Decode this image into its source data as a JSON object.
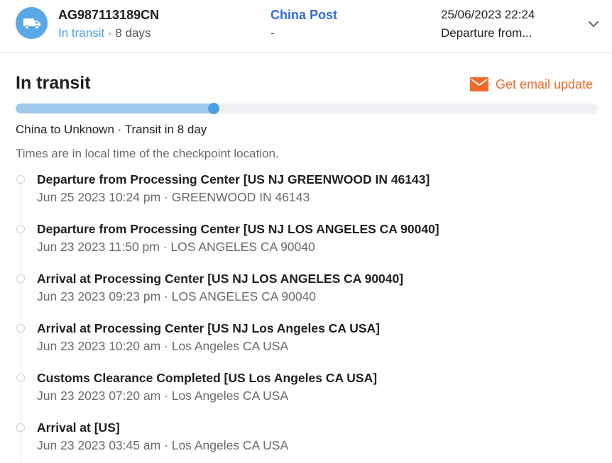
{
  "header": {
    "tracking_number": "AG987113189CN",
    "status": "In transit",
    "duration": " · 8 days",
    "carrier": "China Post",
    "carrier_sub": "-",
    "last_update_time": "25/06/2023 22:24",
    "last_update_event": "Departure from..."
  },
  "main": {
    "title": "In transit",
    "email_button": "Get email update",
    "progress": 0.34,
    "route": "China to Unknown · Transit in 8 day",
    "timezone_note": "Times are in local time of the checkpoint location."
  },
  "events": [
    {
      "title": "Departure from Processing Center [US NJ GREENWOOD IN 46143]",
      "meta": "Jun 25 2023 10:24 pm · GREENWOOD IN 46143"
    },
    {
      "title": "Departure from Processing Center [US NJ LOS ANGELES CA 90040]",
      "meta": "Jun 23 2023 11:50 pm · LOS ANGELES CA 90040"
    },
    {
      "title": "Arrival at Processing Center [US NJ LOS ANGELES CA 90040]",
      "meta": "Jun 23 2023 09:23 pm · LOS ANGELES CA 90040"
    },
    {
      "title": "Arrival at Processing Center [US NJ Los Angeles CA USA]",
      "meta": "Jun 23 2023 10:20 am · Los Angeles CA USA"
    },
    {
      "title": "Customs Clearance Completed [US Los Angeles CA USA]",
      "meta": "Jun 23 2023 07:20 am · Los Angeles CA USA"
    },
    {
      "title": "Arrival at [US]",
      "meta": "Jun 23 2023 03:45 am · Los Angeles CA USA"
    }
  ],
  "colors": {
    "accent_blue": "#4a9fe0",
    "carrier_blue": "#2f6fd6",
    "email_orange": "#f06a2a"
  },
  "icons": {
    "badge": "truck-icon",
    "expand": "chevron-down-icon",
    "email": "mail-icon"
  }
}
